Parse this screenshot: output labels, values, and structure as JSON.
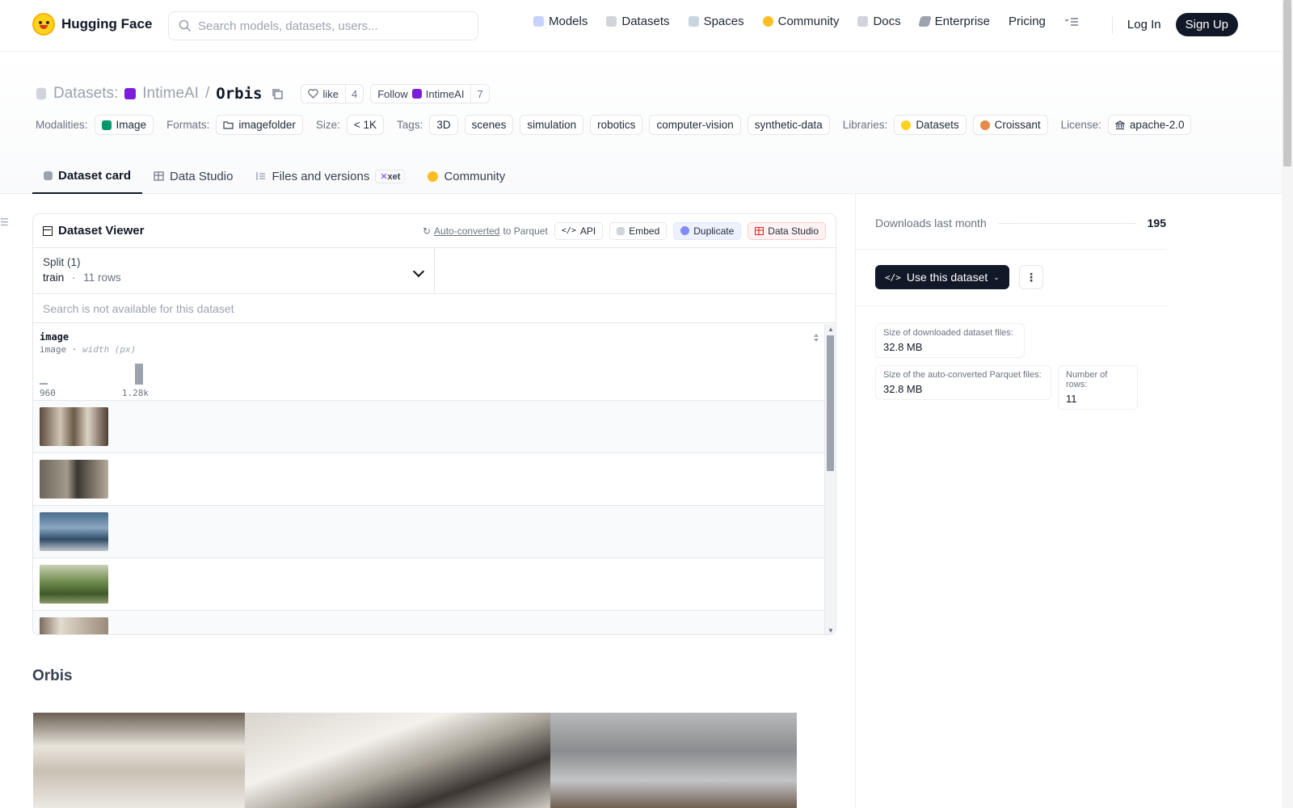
{
  "nav": {
    "brand": "Hugging Face",
    "search_placeholder": "Search models, datasets, users...",
    "links": [
      "Models",
      "Datasets",
      "Spaces",
      "Community",
      "Docs",
      "Enterprise",
      "Pricing"
    ],
    "login": "Log In",
    "signup": "Sign Up"
  },
  "header": {
    "prefix": "Datasets:",
    "org": "IntimeAI",
    "separator": "/",
    "repo": "Orbis",
    "like_label": "like",
    "like_count": "4",
    "follow_label": "Follow",
    "follow_org": "IntimeAI",
    "follow_count": "7"
  },
  "meta": {
    "modalities_label": "Modalities:",
    "modality": "Image",
    "formats_label": "Formats:",
    "format": "imagefolder",
    "size_label": "Size:",
    "size": "< 1K",
    "tags_label": "Tags:",
    "tags": [
      "3D",
      "scenes",
      "simulation",
      "robotics",
      "computer-vision",
      "synthetic-data"
    ],
    "libraries_label": "Libraries:",
    "libraries": [
      "Datasets",
      "Croissant"
    ],
    "license_label": "License:",
    "license": "apache-2.0"
  },
  "tabs": [
    "Dataset card",
    "Data Studio",
    "Files and versions",
    "Community"
  ],
  "xet_badge": "xet",
  "viewer": {
    "title": "Dataset Viewer",
    "auto_link": "Auto-converted",
    "auto_suffix": "to Parquet",
    "actions": [
      "API",
      "Embed",
      "Duplicate",
      "Data Studio"
    ],
    "split_label": "Split (1)",
    "split_value": "train",
    "split_dot": "·",
    "split_rows": "11 rows",
    "search_na": "Search is not available for this dataset",
    "column_name": "image",
    "column_type": "image",
    "column_sep": "·",
    "column_stat": "width (px)",
    "histo_min": "960",
    "histo_max": "1.28k"
  },
  "card": {
    "title": "Orbis"
  },
  "sidebar": {
    "downloads_label": "Downloads last month",
    "downloads_value": "195",
    "use_button": "Use this dataset",
    "stats": [
      {
        "label": "Size of downloaded dataset files:",
        "value": "32.8 MB"
      },
      {
        "label": "Size of the auto-converted Parquet files:",
        "value": "32.8 MB"
      },
      {
        "label": "Number of rows:",
        "value": "11"
      }
    ]
  },
  "colors": {
    "accent": "#111827",
    "org_badge": "#7c1ed9",
    "brand_yellow": "#ffd21e"
  }
}
